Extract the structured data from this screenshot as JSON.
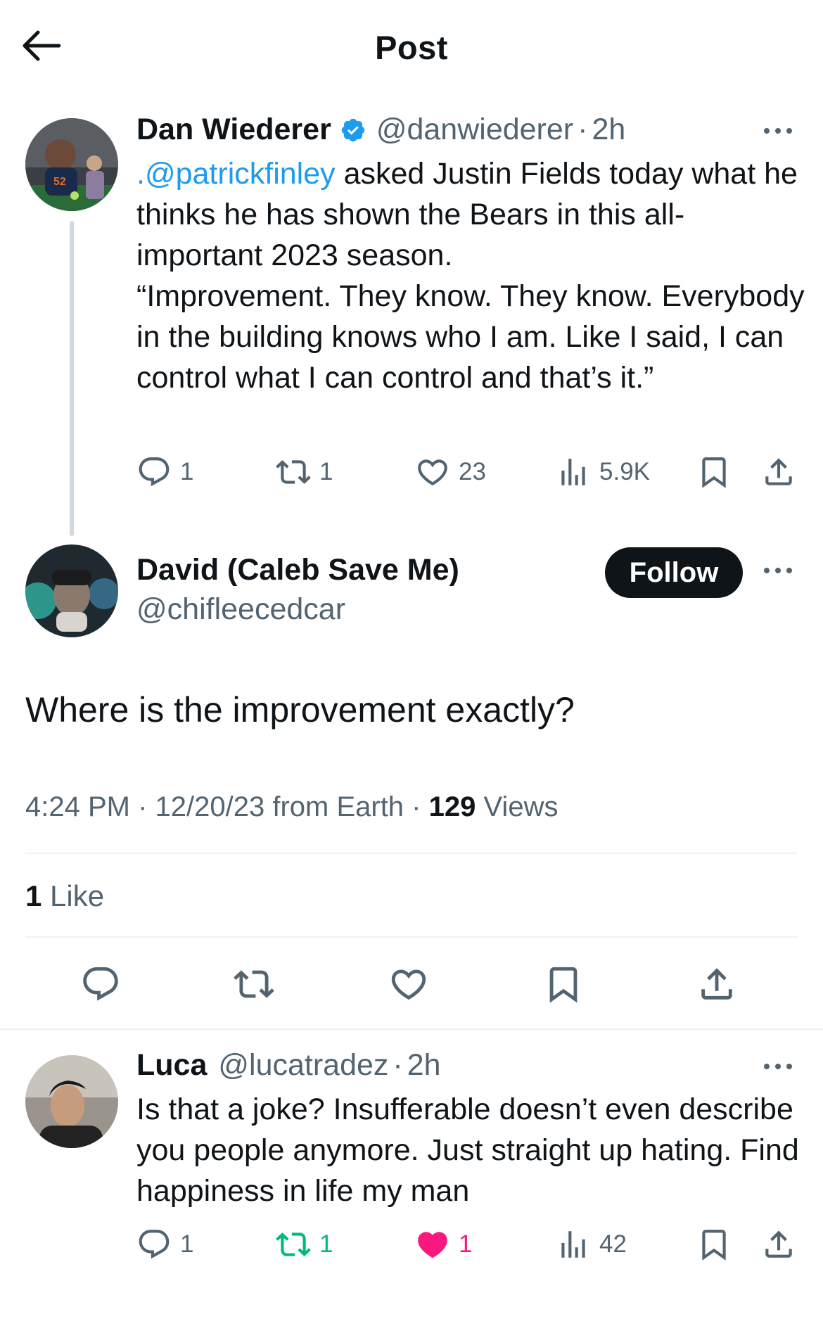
{
  "header": {
    "title": "Post"
  },
  "parent_tweet": {
    "name": "Dan Wiederer",
    "handle": "@danwiederer",
    "dot": "·",
    "time": "2h",
    "mention": ".@patrickfinley",
    "text_rest": " asked Justin Fields today what he thinks he has shown the Bears in this all-important 2023 season.\n“Improvement. They know. They know. Everybody in the building knows who I am. Like I said, I can control what I can control and that’s it.”",
    "replies": "1",
    "reposts": "1",
    "likes": "23",
    "views": "5.9K"
  },
  "main_tweet": {
    "name": "David (Caleb Save Me)",
    "handle": "@chifleecedcar",
    "follow_label": "Follow",
    "text": "Where is the improvement exactly?",
    "time": "4:24 PM",
    "sep1": " · ",
    "date": "12/20/23",
    "source": " from Earth",
    "sep2": " · ",
    "views_count": "129",
    "views_label": " Views",
    "like_count": "1",
    "like_label": " Like"
  },
  "reply_tweet": {
    "name": "Luca",
    "handle": "@lucatradez",
    "dot": "·",
    "time": "2h",
    "text": "Is that a joke? Insufferable doesn’t even describe you people anymore. Just straight up hating. Find happiness in life my man",
    "replies": "1",
    "reposts": "1",
    "likes": "1",
    "views": "42"
  },
  "colors": {
    "text": "#0f1419",
    "secondary": "#536471",
    "link": "#1d9bf0",
    "repost_active": "#00ba7c",
    "like_active": "#f91880",
    "divider": "#eff3f4"
  }
}
